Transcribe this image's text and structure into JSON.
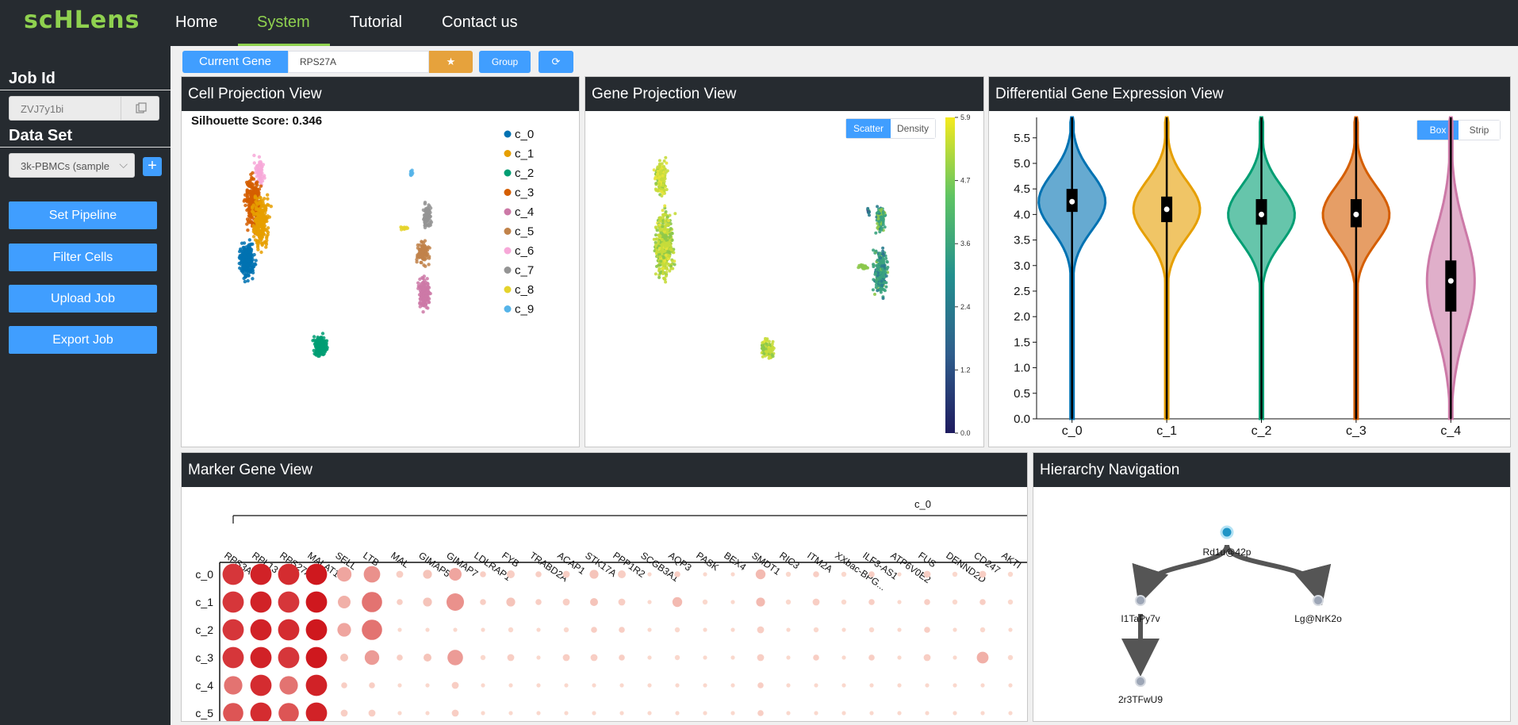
{
  "app": {
    "logo": "scHLens",
    "nav": [
      "Home",
      "System",
      "Tutorial",
      "Contact us"
    ],
    "active_nav": "System"
  },
  "sidebar": {
    "job_id_label": "Job Id",
    "job_id_value": "ZVJ7y1bi",
    "dataset_label": "Data Set",
    "dataset_value": "3k-PBMCs (sample",
    "plus": "+",
    "buttons": [
      "Set Pipeline",
      "Filter Cells",
      "Upload Job",
      "Export Job"
    ]
  },
  "toolbar": {
    "current_gene_label": "Current Gene",
    "gene_value": "RPS27A",
    "star": "★",
    "group_label": "Group",
    "refresh": "⟳"
  },
  "colors": {
    "accent": "#409eff",
    "nav_bg": "#262b30",
    "nav_active": "#8fd14f",
    "star_btn": "#e6a23c"
  },
  "cell_projection": {
    "title": "Cell Projection View",
    "silhouette": "Silhouette Score: 0.346",
    "legend": [
      {
        "label": "c_0",
        "color": "#0072b2"
      },
      {
        "label": "c_1",
        "color": "#e69f00"
      },
      {
        "label": "c_2",
        "color": "#009e73"
      },
      {
        "label": "c_3",
        "color": "#d55e00"
      },
      {
        "label": "c_4",
        "color": "#cc79a7"
      },
      {
        "label": "c_5",
        "color": "#c1834a"
      },
      {
        "label": "c_6",
        "color": "#f7a8d8"
      },
      {
        "label": "c_7",
        "color": "#949494"
      },
      {
        "label": "c_8",
        "color": "#e5d32c"
      },
      {
        "label": "c_9",
        "color": "#56b4e9"
      }
    ]
  },
  "gene_projection": {
    "title": "Gene Projection View",
    "toggle": [
      "Scatter",
      "Density"
    ],
    "active": "Scatter",
    "colorbar_ticks": [
      "5.9",
      "4.7",
      "3.6",
      "2.4",
      "1.2",
      "0.0"
    ]
  },
  "diff_expression": {
    "title": "Differential Gene Expression View",
    "toggle": [
      "Box",
      "Strip"
    ],
    "active": "Box"
  },
  "marker_gene": {
    "title": "Marker Gene View",
    "group_label": "c_0",
    "genes": [
      "RPS3A",
      "RPL13",
      "RPS27A",
      "MALAT1",
      "SELL",
      "LTB",
      "MAL",
      "GIMAP5",
      "GIMAP7",
      "LDLRAP1",
      "FYB",
      "TRABD2A",
      "ACAP1",
      "STK17A",
      "PPP1R2",
      "SCGB3A1",
      "AQP3",
      "PASK",
      "BEX4",
      "SMDT1",
      "RIC3",
      "ITM2A",
      "XXbac-BPG...",
      "ILF3-AS1",
      "ATP6V0E2",
      "FUS",
      "DENND2D",
      "CD247",
      "AKTI"
    ],
    "rows": [
      "c_0",
      "c_1",
      "c_2",
      "c_3",
      "c_4",
      "c_5"
    ]
  },
  "hierarchy": {
    "title": "Hierarchy Navigation",
    "nodes": [
      "Rd1u@42p",
      "I1TaPy7v",
      "Lg@NrK2o",
      "2r3TFwU9"
    ]
  },
  "chart_data": [
    {
      "type": "scatter",
      "title": "Cell Projection View",
      "subtitle": "Silhouette Score: 0.346",
      "series": [
        {
          "name": "c_0"
        },
        {
          "name": "c_1"
        },
        {
          "name": "c_2"
        },
        {
          "name": "c_3"
        },
        {
          "name": "c_4"
        },
        {
          "name": "c_5"
        },
        {
          "name": "c_6"
        },
        {
          "name": "c_7"
        },
        {
          "name": "c_8"
        },
        {
          "name": "c_9"
        }
      ],
      "legend": "right"
    },
    {
      "type": "scatter",
      "title": "Gene Projection View",
      "colorbar": {
        "min": 0.0,
        "max": 5.9,
        "ticks": [
          0.0,
          1.2,
          2.4,
          3.6,
          4.7,
          5.9
        ],
        "colormap": "viridis"
      }
    },
    {
      "type": "violin",
      "title": "Differential Gene Expression View",
      "categories": [
        "c_0",
        "c_1",
        "c_2",
        "c_3",
        "c_4"
      ],
      "colors": [
        "#0072b2",
        "#e69f00",
        "#009e73",
        "#d55e00",
        "#cc79a7"
      ],
      "ylim": [
        0.0,
        5.9
      ],
      "yticks": [
        0.0,
        0.5,
        1.0,
        1.5,
        2.0,
        2.5,
        3.0,
        3.5,
        4.0,
        4.5,
        5.0,
        5.5
      ],
      "medians": [
        4.25,
        4.1,
        4.0,
        4.0,
        2.7
      ],
      "q1": [
        4.05,
        3.85,
        3.8,
        3.75,
        2.1
      ],
      "q3": [
        4.5,
        4.35,
        4.3,
        4.3,
        3.1
      ],
      "min": [
        0.0,
        0.0,
        0.0,
        0.0,
        0.0
      ],
      "max": [
        5.9,
        5.9,
        5.9,
        5.9,
        5.9
      ],
      "modes": [
        4.25,
        4.1,
        4.0,
        4.0,
        2.7
      ]
    },
    {
      "type": "dotplot",
      "title": "Marker Gene View",
      "group": "c_0",
      "x": [
        "RPS3A",
        "RPL13",
        "RPS27A",
        "MALAT1",
        "SELL",
        "LTB",
        "MAL",
        "GIMAP5",
        "GIMAP7",
        "LDLRAP1",
        "FYB",
        "TRABD2A",
        "ACAP1",
        "STK17A",
        "PPP1R2",
        "SCGB3A1",
        "AQP3",
        "PASK",
        "BEX4",
        "SMDT1",
        "RIC3",
        "ITM2A",
        "XXbac-BPG...",
        "ILF3-AS1",
        "ATP6V0E2",
        "FUS",
        "DENND2D",
        "CD247",
        "AKTI"
      ],
      "y": [
        "c_0",
        "c_1",
        "c_2",
        "c_3",
        "c_4",
        "c_5"
      ],
      "size": [
        [
          0.95,
          0.95,
          0.95,
          0.95,
          0.6,
          0.7,
          0.2,
          0.3,
          0.5,
          0.15,
          0.25,
          0.15,
          0.2,
          0.3,
          0.25,
          0.05,
          0.15,
          0.05,
          0.05,
          0.35,
          0.1,
          0.15,
          0.1,
          0.15,
          0.05,
          0.2,
          0.1,
          0.2,
          0.1
        ],
        [
          0.95,
          0.95,
          0.95,
          0.95,
          0.5,
          0.9,
          0.15,
          0.3,
          0.75,
          0.15,
          0.3,
          0.15,
          0.2,
          0.25,
          0.2,
          0.05,
          0.35,
          0.1,
          0.05,
          0.3,
          0.1,
          0.2,
          0.1,
          0.15,
          0.05,
          0.15,
          0.1,
          0.15,
          0.1
        ],
        [
          0.95,
          0.95,
          0.95,
          0.95,
          0.55,
          0.9,
          0.05,
          0.05,
          0.05,
          0.05,
          0.1,
          0.05,
          0.1,
          0.15,
          0.15,
          0.05,
          0.1,
          0.05,
          0.05,
          0.2,
          0.05,
          0.1,
          0.05,
          0.1,
          0.05,
          0.15,
          0.05,
          0.1,
          0.05
        ],
        [
          0.95,
          0.95,
          0.95,
          0.95,
          0.25,
          0.6,
          0.15,
          0.25,
          0.65,
          0.1,
          0.2,
          0.05,
          0.2,
          0.2,
          0.15,
          0.05,
          0.1,
          0.05,
          0.05,
          0.2,
          0.05,
          0.15,
          0.05,
          0.15,
          0.05,
          0.2,
          0.05,
          0.45,
          0.1
        ],
        [
          0.8,
          0.95,
          0.8,
          0.95,
          0.15,
          0.15,
          0.05,
          0.05,
          0.2,
          0.05,
          0.05,
          0.05,
          0.05,
          0.05,
          0.05,
          0.05,
          0.05,
          0.05,
          0.05,
          0.15,
          0.05,
          0.05,
          0.05,
          0.05,
          0.05,
          0.05,
          0.05,
          0.05,
          0.05
        ],
        [
          0.9,
          0.95,
          0.9,
          0.95,
          0.2,
          0.2,
          0.05,
          0.05,
          0.2,
          0.05,
          0.05,
          0.05,
          0.05,
          0.05,
          0.05,
          0.05,
          0.05,
          0.05,
          0.05,
          0.15,
          0.05,
          0.05,
          0.05,
          0.05,
          0.05,
          0.05,
          0.05,
          0.05,
          0.05
        ]
      ],
      "intensity": [
        [
          0.85,
          0.95,
          0.9,
          1.0,
          0.3,
          0.4,
          0.1,
          0.15,
          0.3,
          0.1,
          0.1,
          0.1,
          0.1,
          0.15,
          0.1,
          0.05,
          0.1,
          0.05,
          0.05,
          0.2,
          0.05,
          0.1,
          0.05,
          0.1,
          0.05,
          0.1,
          0.05,
          0.1,
          0.05
        ],
        [
          0.85,
          0.95,
          0.85,
          1.0,
          0.25,
          0.55,
          0.1,
          0.15,
          0.4,
          0.1,
          0.15,
          0.1,
          0.1,
          0.15,
          0.1,
          0.05,
          0.2,
          0.05,
          0.05,
          0.2,
          0.05,
          0.1,
          0.05,
          0.1,
          0.05,
          0.1,
          0.05,
          0.1,
          0.05
        ],
        [
          0.85,
          0.95,
          0.9,
          1.0,
          0.3,
          0.55,
          0.05,
          0.05,
          0.05,
          0.05,
          0.05,
          0.05,
          0.05,
          0.1,
          0.1,
          0.05,
          0.05,
          0.05,
          0.05,
          0.1,
          0.05,
          0.05,
          0.05,
          0.05,
          0.05,
          0.1,
          0.05,
          0.05,
          0.05
        ],
        [
          0.85,
          0.95,
          0.85,
          1.0,
          0.15,
          0.35,
          0.1,
          0.15,
          0.35,
          0.05,
          0.1,
          0.05,
          0.1,
          0.1,
          0.1,
          0.05,
          0.05,
          0.05,
          0.05,
          0.1,
          0.05,
          0.1,
          0.05,
          0.1,
          0.05,
          0.1,
          0.05,
          0.25,
          0.05
        ],
        [
          0.55,
          0.9,
          0.55,
          0.95,
          0.1,
          0.1,
          0.05,
          0.05,
          0.1,
          0.05,
          0.05,
          0.05,
          0.05,
          0.05,
          0.05,
          0.05,
          0.05,
          0.05,
          0.05,
          0.1,
          0.05,
          0.05,
          0.05,
          0.05,
          0.05,
          0.05,
          0.05,
          0.05,
          0.05
        ],
        [
          0.7,
          0.9,
          0.7,
          0.95,
          0.1,
          0.1,
          0.05,
          0.05,
          0.1,
          0.05,
          0.05,
          0.05,
          0.05,
          0.05,
          0.05,
          0.05,
          0.05,
          0.05,
          0.05,
          0.1,
          0.05,
          0.05,
          0.05,
          0.05,
          0.05,
          0.05,
          0.05,
          0.05,
          0.05
        ]
      ]
    }
  ]
}
